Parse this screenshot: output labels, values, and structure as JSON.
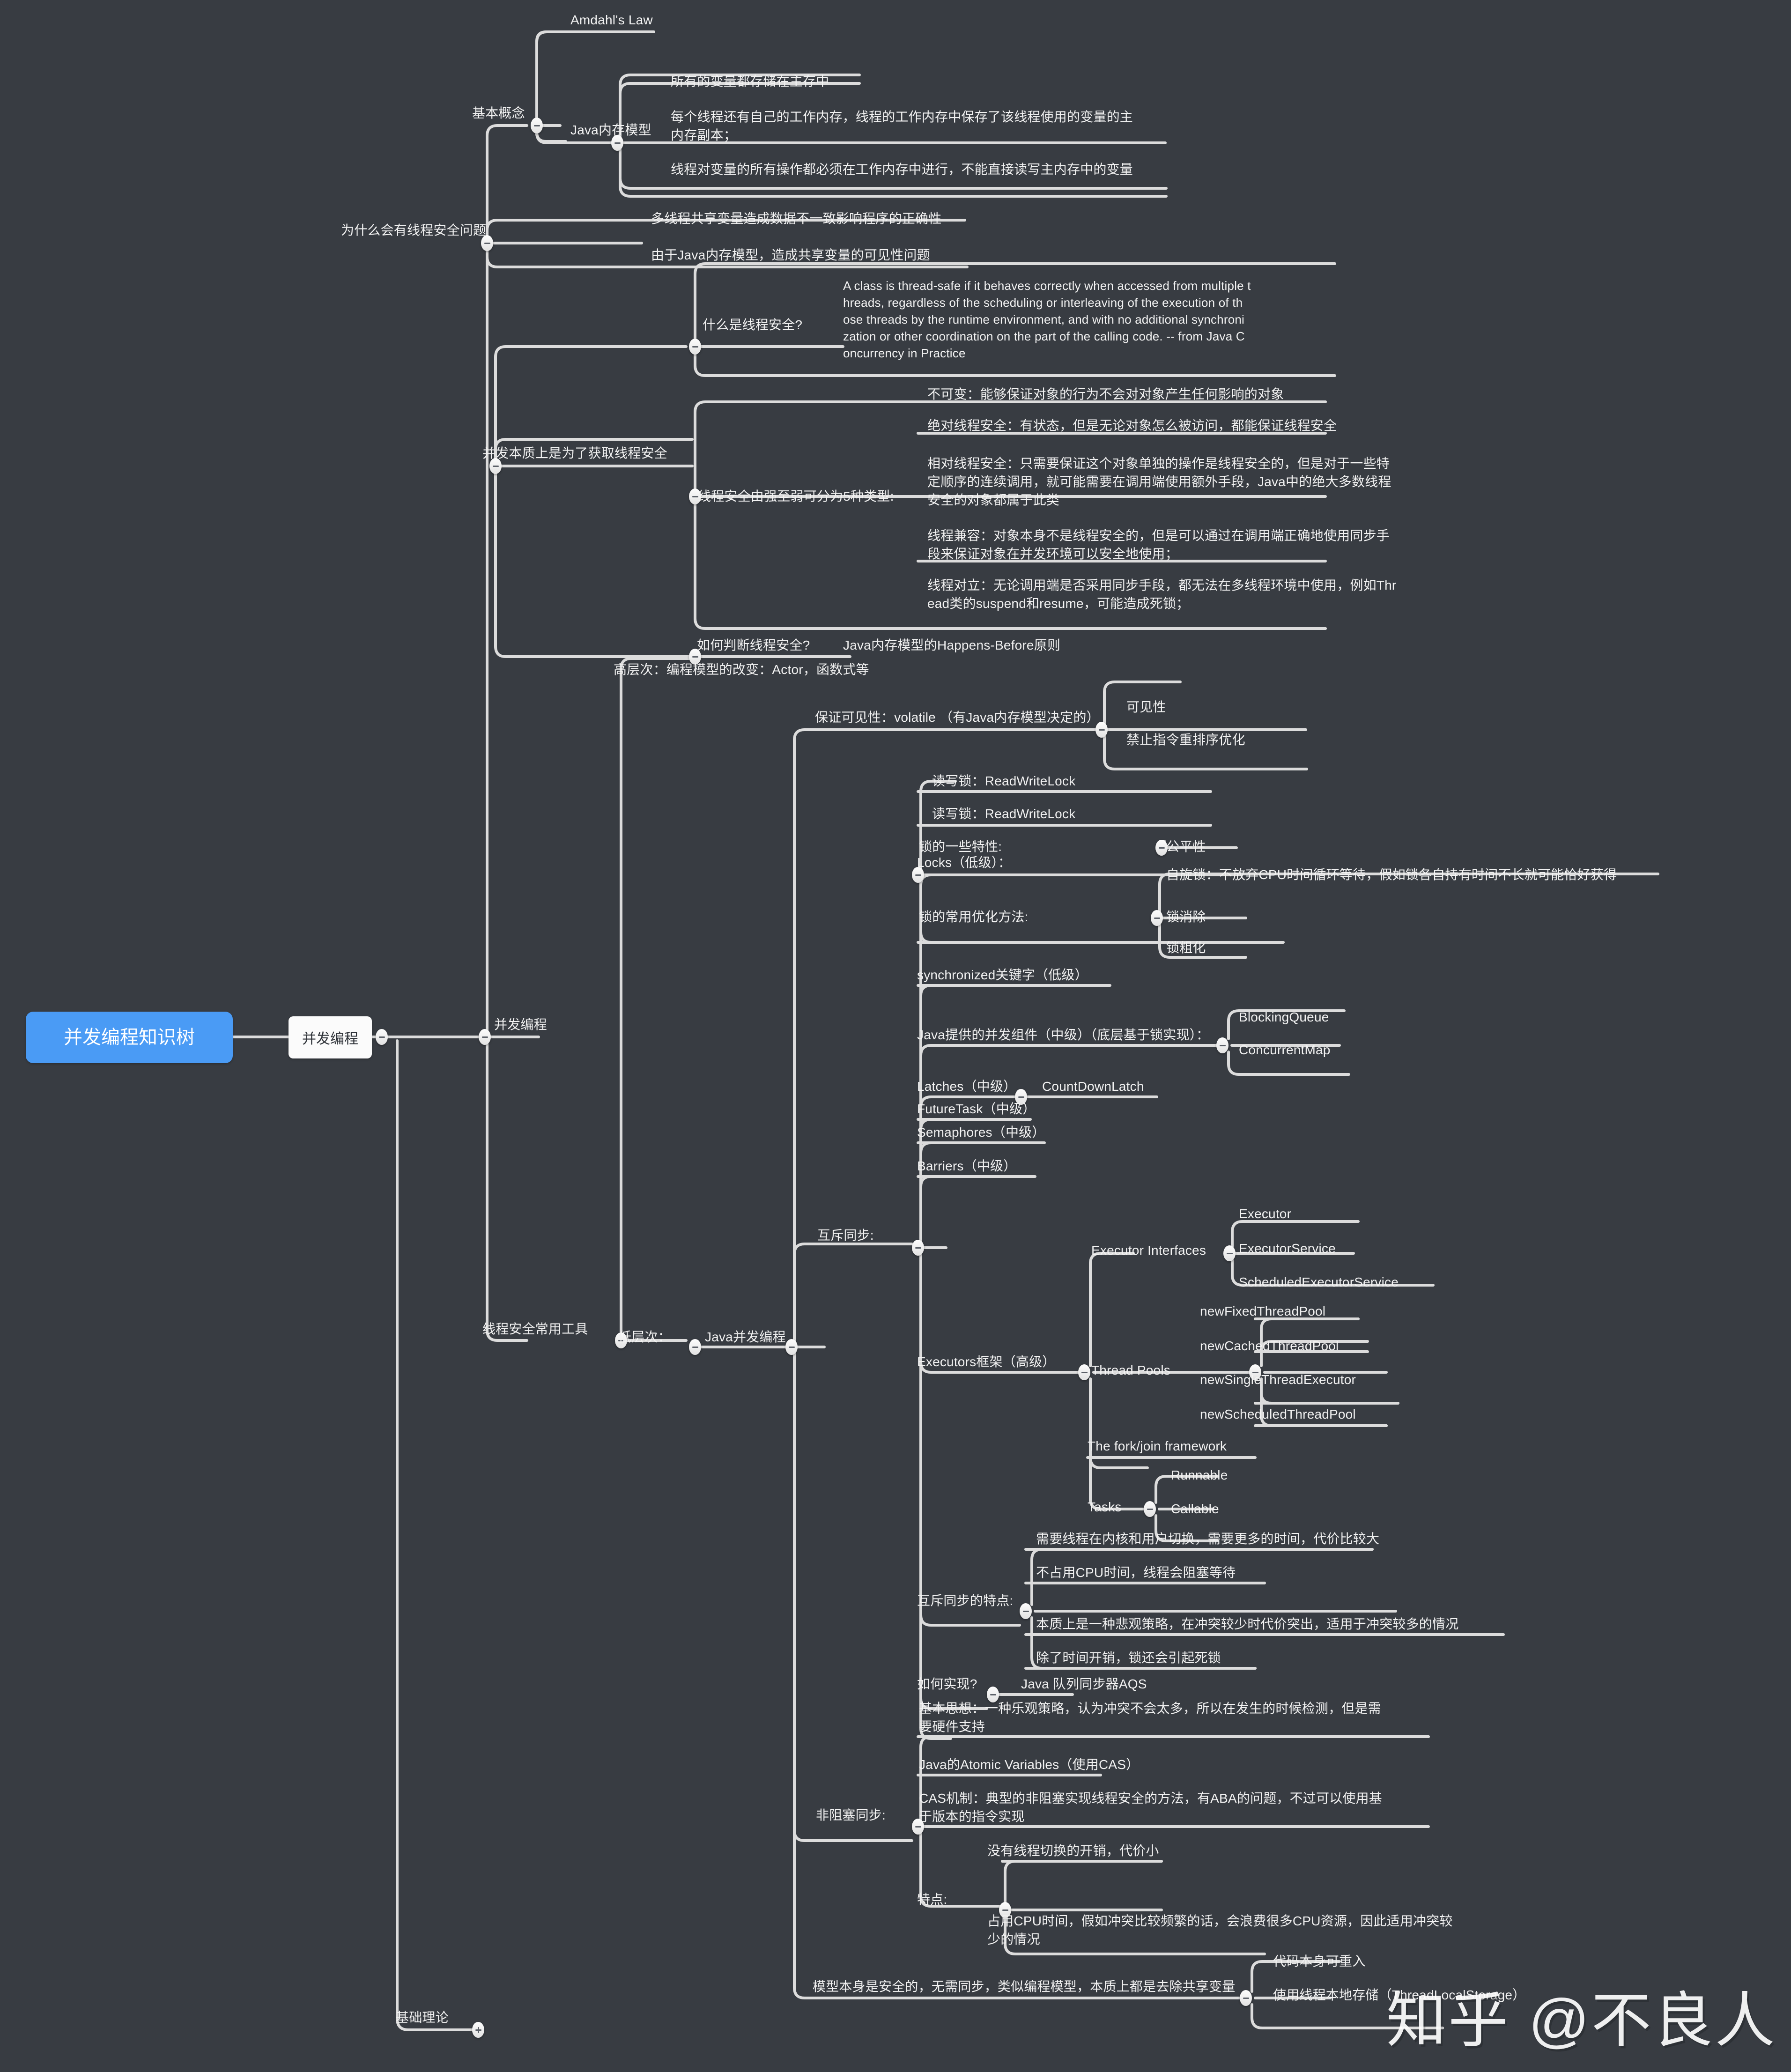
{
  "theme": {
    "background": "#383c42",
    "root_fill": "#4a9bf5",
    "level1_fill": "#fbfbfb",
    "wire": "#dcdcdc",
    "text": "#f2f2f2"
  },
  "watermark": "知乎 @不良人",
  "root": {
    "label": "并发编程知识树"
  },
  "level1": {
    "label": "并发编程"
  },
  "branches": [
    {
      "label": "并发编程"
    },
    {
      "label": "基础理论"
    }
  ],
  "nodes": {
    "basic_concepts": "基本概念",
    "amdahl": "Amdahl's Law",
    "jmm": "Java内存模型",
    "jmm_1": "所有的变量都存储在主存中",
    "jmm_2": "每个线程还有自己的工作内存，线程的工作内存中保存了该线程使用的变量的主\n内存副本；",
    "jmm_3": "线程对变量的所有操作都必须在工作内存中进行，不能直接读写主内存中的变量",
    "why_thread_safety": "为什么会有线程安全问题",
    "why_1": "多线程共享变量造成数据不一致影响程序的正确性",
    "why_2": "由于Java内存模型，造成共享变量的可见性问题",
    "concurrency_essence": "并发本质上是为了获取线程安全",
    "what_is_thread_safe": "什么是线程安全?",
    "thread_safe_quote": "A class is thread-safe if it behaves correctly when accessed from multiple t\nhreads, regardless of the scheduling or interleaving of the execution of th\nose threads by the runtime environment, and with no additional synchroni\nzation or other coordination on the part of the calling code. -- from Java C\noncurrency in Practice",
    "five_types": "线程安全由强至弱可分为5种类型:",
    "type_1": "不可变：能够保证对象的行为不会对对象产生任何影响的对象",
    "type_2": "绝对线程安全：有状态，但是无论对象怎么被访问，都能保证线程安全",
    "type_3": "相对线程安全：只需要保证这个对象单独的操作是线程安全的，但是对于一些特\n定顺序的连续调用，就可能需要在调用端使用额外手段，Java中的绝大多数线程\n安全的对象都属于此类",
    "type_4": "线程兼容：对象本身不是线程安全的，但是可以通过在调用端正确地使用同步手\n段来保证对象在并发环境可以安全地使用；",
    "type_5": "线程对立：无论调用端是否采用同步手段，都无法在多线程环境中使用，例如Thr\nead类的suspend和resume，可能造成死锁；",
    "how_judge": "如何判断线程安全?",
    "happens_before": "Java内存模型的Happens-Before原则",
    "high_level": "高层次：编程模型的改变：Actor，函数式等",
    "thread_safe_tools": "线程安全常用工具",
    "low_level": "低层次：",
    "java_concurrency": "Java并发编程",
    "volatile": "保证可见性：volatile （有Java内存模型决定的）",
    "volatile_1": "可见性",
    "volatile_2": "禁止指令重排序优化",
    "mutex_sync": "互斥同步:",
    "locks": "Locks（低级）：",
    "locks_1": "读写锁：ReadWriteLock",
    "locks_2": "读写锁：ReadWriteLock",
    "lock_features": "锁的一些特性:",
    "lock_feature_1": "公平性",
    "lock_opt": "锁的常用优化方法:",
    "spinlock": "自旋锁：不放弃CPU时间循环等待，假如锁各自持有时间不长就可能恰好获得",
    "lock_elimination": "锁消除",
    "lock_coarsening": "锁粗化",
    "synchronized": "synchronized关键字（低级）",
    "java_components": "Java提供的并发组件（中级）（底层基于锁实现）：",
    "blocking_queue": "BlockingQueue",
    "concurrent_map": "ConcurrentMap",
    "latches": "Latches（中级）",
    "countdownlatch": "CountDownLatch",
    "futuretask": "FutureTask（中级）",
    "semaphores": "Semaphores（中级）",
    "barriers": "Barriers（中级）",
    "executors": "Executors框架（高级）",
    "executor_interfaces": "Executor Interfaces",
    "executor": "Executor",
    "executor_service": "ExecutorService",
    "scheduled_executor_service": "ScheduledExecutorService",
    "thread_pools": "Thread Pools",
    "new_fixed": "newFixedThreadPool",
    "new_cached": "newCachedThreadPool",
    "new_single": "newSingleThreadExecutor",
    "new_scheduled": "newScheduledThreadPool",
    "forkjoin": "The fork/join framework",
    "tasks": "Tasks",
    "runnable": "Runnable",
    "callable": "Callable",
    "mutex_features": "互斥同步的特点:",
    "mutex_f1": "需要线程在内核和用户切换，需要更多的时间，代价比较大",
    "mutex_f2": "不占用CPU时间，线程会阻塞等待",
    "mutex_f3": "本质上是一种悲观策略，在冲突较少时代价突出，适用于冲突较多的情况",
    "mutex_f4": "除了时间开销，锁还会引起死锁",
    "how_impl": "如何实现?",
    "aqs": "Java 队列同步器AQS",
    "nonblocking": "非阻塞同步:",
    "nb_1": "基本思想：一种乐观策略，认为冲突不会太多，所以在发生的时候检测，但是需\n要硬件支持",
    "nb_2": "Java的Atomic Variables（使用CAS）",
    "nb_3": "CAS机制：典型的非阻塞实现线程安全的方法，有ABA的问题，不过可以使用基\n于版本的指令实现",
    "nb_features": "特点:",
    "nb_f1": "没有线程切换的开销，代价小",
    "nb_f2": "占用CPU时间，假如冲突比较频繁的话，会浪费很多CPU资源，因此适用冲突较\n少的情况",
    "model_safe": "模型本身是安全的，无需同步，类似编程模型，本质上都是去除共享变量",
    "ms_1": "代码本身可重入",
    "ms_2": "使用线程本地存储（ThreadLocalStorage）",
    "basic_theory": "基础理论"
  }
}
